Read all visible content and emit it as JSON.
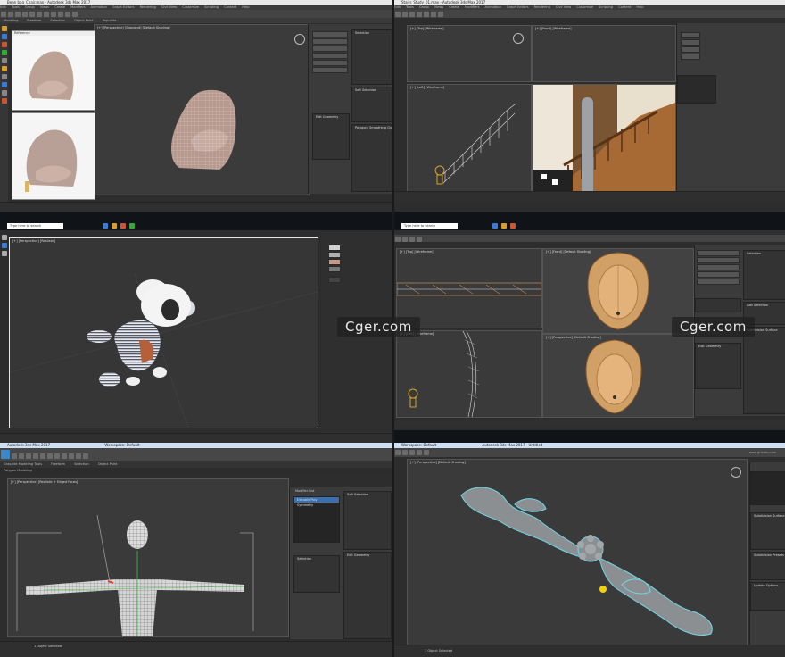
{
  "panels": {
    "chair": {
      "title": "Bean bag_Chair.max - Autodesk 3ds Max 2017",
      "menus": [
        "Edit",
        "Tools",
        "Group",
        "Views",
        "Create",
        "Modifiers",
        "Animation",
        "Graph Editors",
        "Rendering",
        "Civil View",
        "Customize",
        "Scripting",
        "Content",
        "Help"
      ],
      "ribbon": [
        "Modeling",
        "Freeform",
        "Selection",
        "Object Paint",
        "Populate"
      ],
      "viewport_label": "[+] [Perspective] [Standard] [Default Shading]",
      "ref_window_title": "Reference",
      "rollouts": [
        "Selection",
        "Soft Selection",
        "Edit Geometry",
        "Polygon: Smoothing Groups"
      ]
    },
    "stairs": {
      "title": "Stairs_Study_01.max - Autodesk 3ds Max 2017",
      "menus": [
        "Edit",
        "Tools",
        "Group",
        "Views",
        "Create",
        "Modifiers",
        "Animation",
        "Graph Editors",
        "Rendering",
        "Civil View",
        "Customize",
        "Scripting",
        "Content",
        "Help"
      ],
      "viewports": [
        "[+] [Top] [Wireframe]",
        "[+] [Front] [Wireframe]",
        "[+] [Left] [Wireframe]",
        "[+] [Perspective] [Realistic]"
      ]
    },
    "teddy": {
      "taskbar_search": "Type here to search",
      "viewport_label": "[+] [Perspective] [Realistic]"
    },
    "mirror": {
      "taskbar_search": "Type here to search",
      "viewports": [
        "[+] [Top] [Wireframe]",
        "[+] [Front] [Default Shading]",
        "[+] [Left] [Wireframe]",
        "[+] [Perspective] [Default Shading]"
      ],
      "rollouts": [
        "Selection",
        "Soft Selection",
        "Edit Geometry",
        "Subdivision Surface"
      ]
    },
    "figure": {
      "title": "Autodesk 3ds Max 2017",
      "workspace": "Workspace: Default",
      "ribbon": [
        "Graphite Modeling Tools",
        "Freeform",
        "Selection",
        "Object Paint"
      ],
      "ribbon_sub": "Polygon Modeling",
      "viewport_label": "[+] [Perspective] [Realistic + Edged Faces]",
      "modifier_list": "Modifier List",
      "stack": [
        "Editable Poly",
        "Symmetry"
      ],
      "rollouts": [
        "Selection",
        "Soft Selection",
        "Edit Geometry"
      ],
      "status": "1 Object Selected"
    },
    "ornament": {
      "title": "Autodesk 3ds Max 2017 - Untitled",
      "workspace": "Workspace: Default",
      "viewport_label": "[+] [Perspective] [Default Shading]",
      "site": "www.grivoto.com",
      "rollouts": [
        "Subdivision Surface",
        "Subdivision Presets",
        "Update Options"
      ],
      "status": "1 Object Selected"
    }
  },
  "watermarks": [
    "Cger.com",
    "Cger.com"
  ],
  "colors": {
    "chair_fabric": "#b8998e",
    "wood": "#b07a45",
    "ornament": "#8c8f92",
    "selection_cyan": "#6fd6e6",
    "mirror_gold": "#d0a066"
  }
}
